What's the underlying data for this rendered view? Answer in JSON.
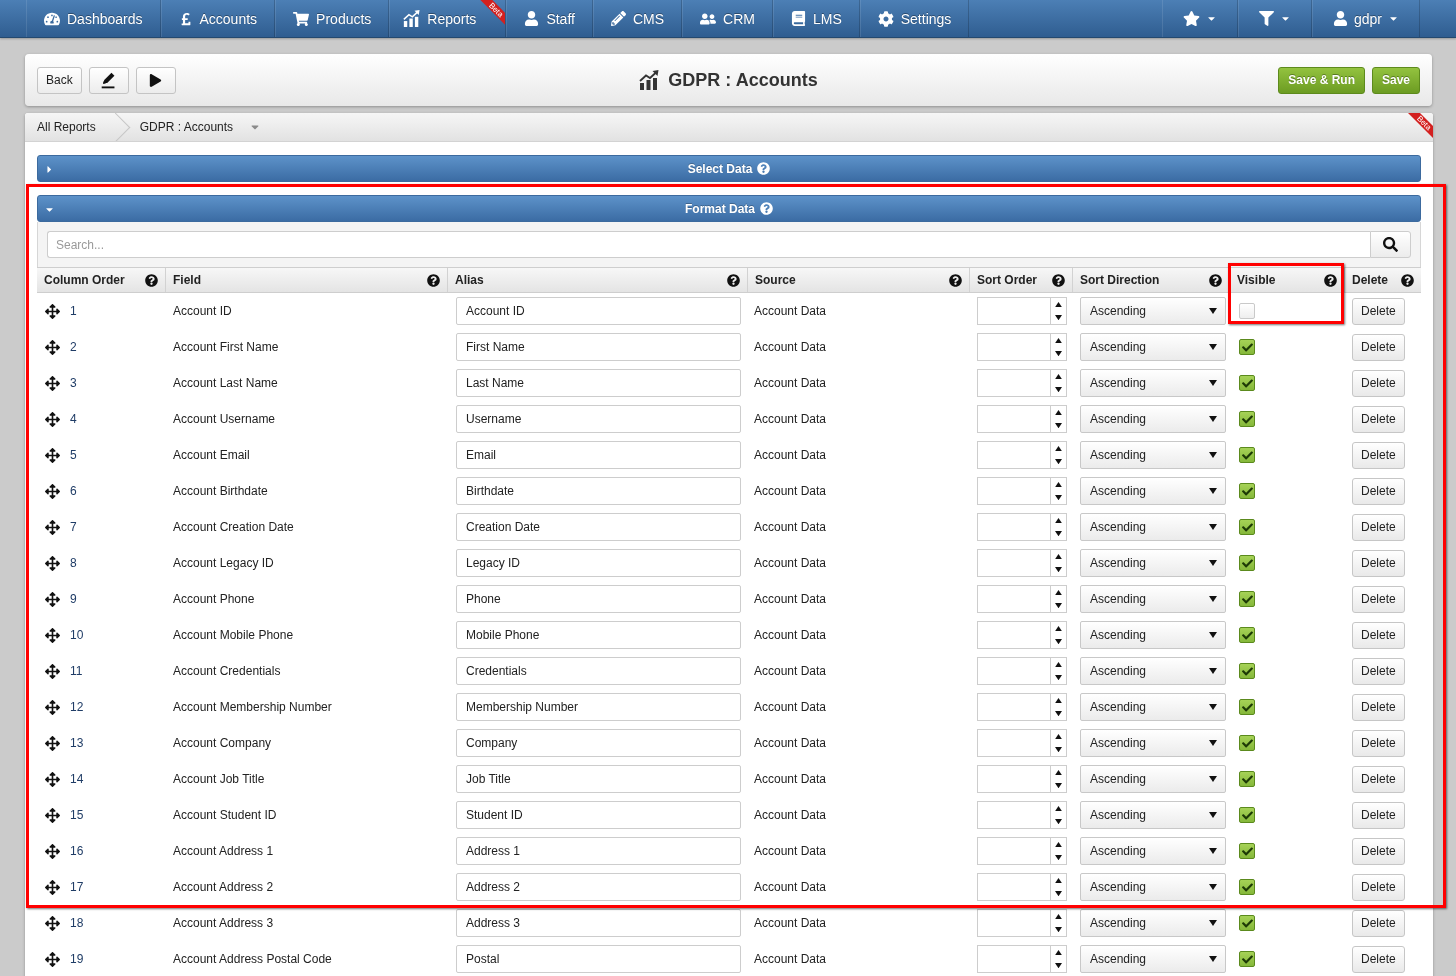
{
  "nav": {
    "items": [
      {
        "label": "Dashboards"
      },
      {
        "label": "Accounts"
      },
      {
        "label": "Products"
      },
      {
        "label": "Reports",
        "badge": "Beta"
      },
      {
        "label": "Staff"
      },
      {
        "label": "CMS"
      },
      {
        "label": "CRM"
      },
      {
        "label": "LMS"
      },
      {
        "label": "Settings"
      }
    ],
    "user": {
      "label": "gdpr"
    }
  },
  "toolbar": {
    "back": "Back",
    "title": "GDPR : Accounts",
    "actions": [
      {
        "label": "Save & Run"
      },
      {
        "label": "Save"
      }
    ]
  },
  "breadcrumb": [
    {
      "label": "All Reports"
    },
    {
      "label": "GDPR : Accounts"
    }
  ],
  "card_badge": "Beta",
  "select_data": {
    "title": "Select Data",
    "expanded": false
  },
  "format_data": {
    "title": "Format Data",
    "expanded": true,
    "framed": true,
    "search": {
      "placeholder": "Search..."
    },
    "columns": [
      {
        "label": "Column Order",
        "framed": false
      },
      {
        "label": "Field",
        "framed": false
      },
      {
        "label": "Alias",
        "framed": false
      },
      {
        "label": "Source",
        "framed": false
      },
      {
        "label": "Sort Order",
        "framed": false
      },
      {
        "label": "Sort Direction",
        "framed": false
      },
      {
        "label": "Visible",
        "framed": true
      },
      {
        "label": "Delete",
        "framed": false
      }
    ],
    "rows": [
      {
        "order": "1",
        "field": "Account ID",
        "alias": "Account ID",
        "source": "Account Data",
        "sort_direction": "Ascending",
        "visible": false,
        "delete": "Delete",
        "framed": true
      },
      {
        "order": "2",
        "field": "Account First Name",
        "alias": "First Name",
        "source": "Account Data",
        "sort_direction": "Ascending",
        "visible": true,
        "delete": "Delete",
        "framed": true
      },
      {
        "order": "3",
        "field": "Account Last Name",
        "alias": "Last Name",
        "source": "Account Data",
        "sort_direction": "Ascending",
        "visible": true,
        "delete": "Delete",
        "framed": true
      },
      {
        "order": "4",
        "field": "Account Username",
        "alias": "Username",
        "source": "Account Data",
        "sort_direction": "Ascending",
        "visible": true,
        "delete": "Delete",
        "framed": true
      },
      {
        "order": "5",
        "field": "Account Email",
        "alias": "Email",
        "source": "Account Data",
        "sort_direction": "Ascending",
        "visible": true,
        "delete": "Delete",
        "framed": true
      },
      {
        "order": "6",
        "field": "Account Birthdate",
        "alias": "Birthdate",
        "source": "Account Data",
        "sort_direction": "Ascending",
        "visible": true,
        "delete": "Delete",
        "framed": true
      },
      {
        "order": "7",
        "field": "Account Creation Date",
        "alias": "Creation Date",
        "source": "Account Data",
        "sort_direction": "Ascending",
        "visible": true,
        "delete": "Delete",
        "framed": true
      },
      {
        "order": "8",
        "field": "Account Legacy ID",
        "alias": "Legacy ID",
        "source": "Account Data",
        "sort_direction": "Ascending",
        "visible": true,
        "delete": "Delete",
        "framed": true
      },
      {
        "order": "9",
        "field": "Account Phone",
        "alias": "Phone",
        "source": "Account Data",
        "sort_direction": "Ascending",
        "visible": true,
        "delete": "Delete",
        "framed": true
      },
      {
        "order": "10",
        "field": "Account Mobile Phone",
        "alias": "Mobile Phone",
        "source": "Account Data",
        "sort_direction": "Ascending",
        "visible": true,
        "delete": "Delete",
        "framed": true
      },
      {
        "order": "11",
        "field": "Account Credentials",
        "alias": "Credentials",
        "source": "Account Data",
        "sort_direction": "Ascending",
        "visible": true,
        "delete": "Delete",
        "framed": true
      },
      {
        "order": "12",
        "field": "Account Membership Number",
        "alias": "Membership Number",
        "source": "Account Data",
        "sort_direction": "Ascending",
        "visible": true,
        "delete": "Delete",
        "framed": true
      },
      {
        "order": "13",
        "field": "Account Company",
        "alias": "Company",
        "source": "Account Data",
        "sort_direction": "Ascending",
        "visible": true,
        "delete": "Delete",
        "framed": true
      },
      {
        "order": "14",
        "field": "Account Job Title",
        "alias": "Job Title",
        "source": "Account Data",
        "sort_direction": "Ascending",
        "visible": true,
        "delete": "Delete",
        "framed": true
      },
      {
        "order": "15",
        "field": "Account Student ID",
        "alias": "Student ID",
        "source": "Account Data",
        "sort_direction": "Ascending",
        "visible": true,
        "delete": "Delete",
        "framed": true
      },
      {
        "order": "16",
        "field": "Account Address 1",
        "alias": "Address 1",
        "source": "Account Data",
        "sort_direction": "Ascending",
        "visible": true,
        "delete": "Delete",
        "framed": true
      },
      {
        "order": "17",
        "field": "Account Address 2",
        "alias": "Address 2",
        "source": "Account Data",
        "sort_direction": "Ascending",
        "visible": true,
        "delete": "Delete",
        "framed": true
      },
      {
        "order": "18",
        "field": "Account Address 3",
        "alias": "Address 3",
        "source": "Account Data",
        "sort_direction": "Ascending",
        "visible": true,
        "delete": "Delete",
        "framed": false
      },
      {
        "order": "19",
        "field": "Account Address Postal Code",
        "alias": "Postal",
        "source": "Account Data",
        "sort_direction": "Ascending",
        "visible": true,
        "delete": "Delete",
        "framed": false
      }
    ]
  }
}
